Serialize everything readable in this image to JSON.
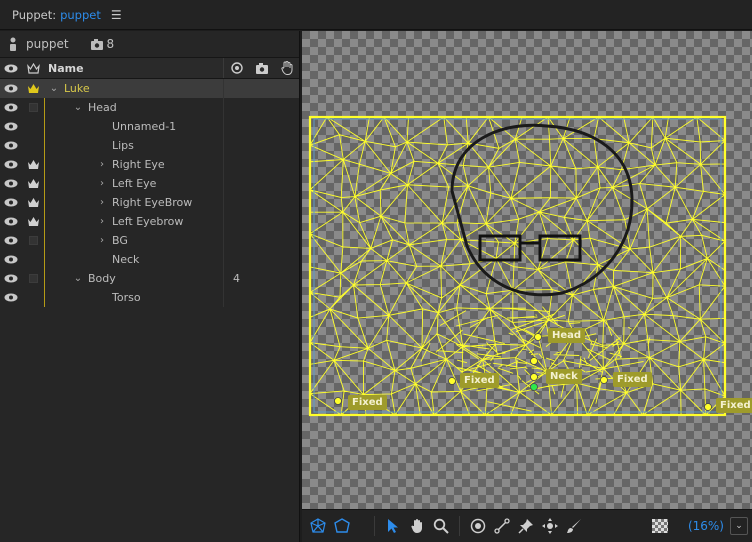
{
  "title": {
    "prefix": "Puppet:",
    "doc_name": "puppet",
    "menu_icon": "hamburger-icon"
  },
  "puppet": {
    "name": "puppet",
    "count": "8"
  },
  "header": {
    "name": "Name"
  },
  "layers": [
    {
      "name": "Luke",
      "indent": 0,
      "chev": "⌄",
      "crown": "filled",
      "selected": true,
      "val": ""
    },
    {
      "name": "Head",
      "indent": 1,
      "chev": "⌄",
      "crown": "box",
      "selected": false,
      "val": ""
    },
    {
      "name": "Unnamed-1",
      "indent": 2,
      "chev": "",
      "crown": "none",
      "selected": false,
      "val": ""
    },
    {
      "name": "Lips",
      "indent": 2,
      "chev": "",
      "crown": "none",
      "selected": false,
      "val": ""
    },
    {
      "name": "Right Eye",
      "indent": 2,
      "chev": "›",
      "crown": "outline",
      "selected": false,
      "val": ""
    },
    {
      "name": "Left Eye",
      "indent": 2,
      "chev": "›",
      "crown": "outline",
      "selected": false,
      "val": ""
    },
    {
      "name": "Right EyeBrow",
      "indent": 2,
      "chev": "›",
      "crown": "outline",
      "selected": false,
      "val": ""
    },
    {
      "name": "Left Eyebrow",
      "indent": 2,
      "chev": "›",
      "crown": "outline",
      "selected": false,
      "val": ""
    },
    {
      "name": "BG",
      "indent": 2,
      "chev": "›",
      "crown": "box",
      "selected": false,
      "val": ""
    },
    {
      "name": "Neck",
      "indent": 2,
      "chev": "",
      "crown": "none",
      "selected": false,
      "val": ""
    },
    {
      "name": "Body",
      "indent": 1,
      "chev": "⌄",
      "crown": "box",
      "selected": false,
      "val": "4"
    },
    {
      "name": "Torso",
      "indent": 2,
      "chev": "",
      "crown": "none",
      "selected": false,
      "val": ""
    }
  ],
  "handles": {
    "head": "Head",
    "neck": "Neck",
    "fixed": "Fixed"
  },
  "zoom": "(16%)",
  "colors": {
    "accent": "#2d8ceb",
    "mesh": "#ffff2a",
    "handle": "#9e9b2b",
    "selected_text": "#d7c84a"
  }
}
